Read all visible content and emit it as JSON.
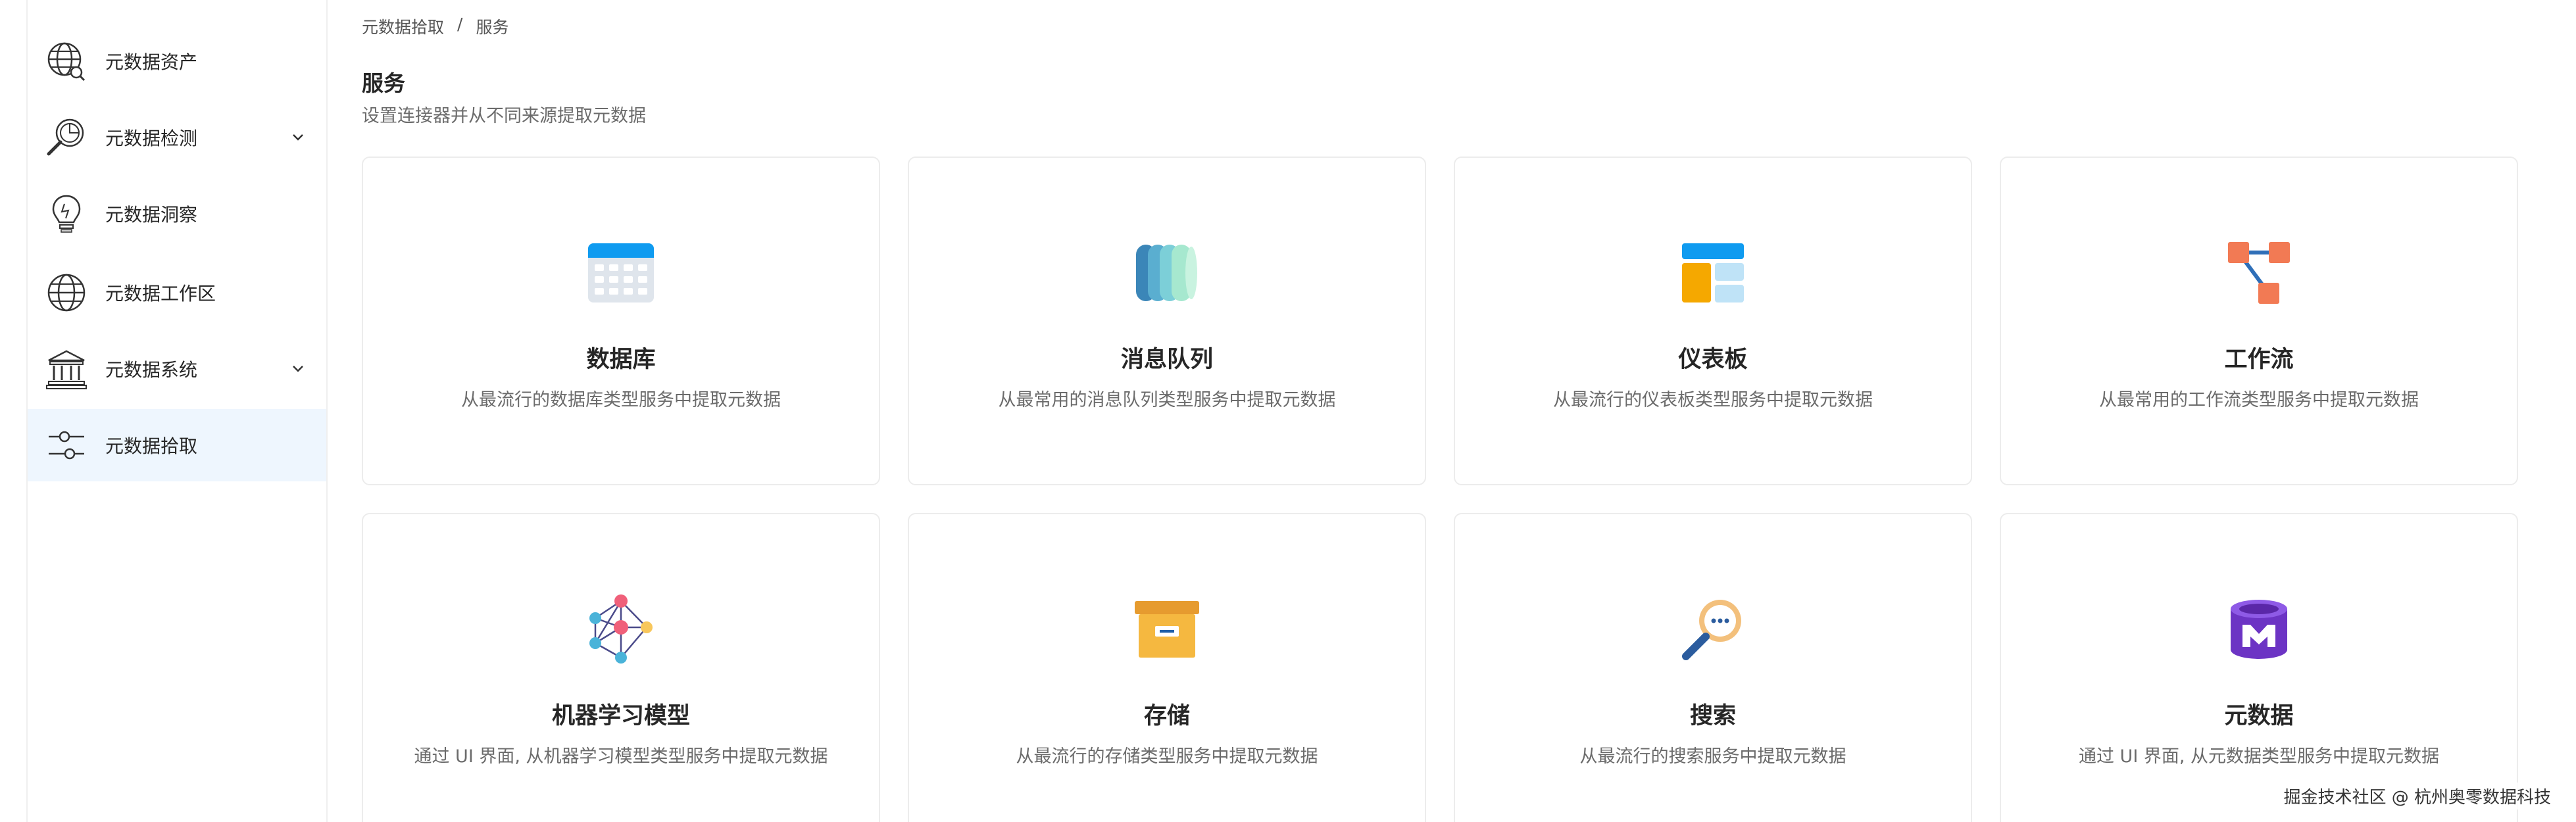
{
  "sidebar": {
    "items": [
      {
        "label": "元数据资产",
        "icon": "globe-search-icon",
        "has_chevron": false,
        "active": false
      },
      {
        "label": "元数据检测",
        "icon": "magnifier-chart-icon",
        "has_chevron": true,
        "active": false
      },
      {
        "label": "元数据洞察",
        "icon": "lightbulb-icon",
        "has_chevron": false,
        "active": false
      },
      {
        "label": "元数据工作区",
        "icon": "globe-icon",
        "has_chevron": false,
        "active": false
      },
      {
        "label": "元数据系统",
        "icon": "bank-building-icon",
        "has_chevron": true,
        "active": false
      },
      {
        "label": "元数据拾取",
        "icon": "sliders-icon",
        "has_chevron": false,
        "active": true
      }
    ]
  },
  "breadcrumb": {
    "items": [
      "元数据拾取",
      "服务"
    ],
    "separator": "/"
  },
  "page": {
    "title": "服务",
    "subtitle": "设置连接器并从不同来源提取元数据"
  },
  "cards": [
    {
      "title": "数据库",
      "description": "从最流行的数据库类型服务中提取元数据",
      "icon": "database-table-icon"
    },
    {
      "title": "消息队列",
      "description": "从最常用的消息队列类型服务中提取元数据",
      "icon": "message-queue-icon"
    },
    {
      "title": "仪表板",
      "description": "从最流行的仪表板类型服务中提取元数据",
      "icon": "dashboard-icon"
    },
    {
      "title": "工作流",
      "description": "从最常用的工作流类型服务中提取元数据",
      "icon": "workflow-icon"
    },
    {
      "title": "机器学习模型",
      "description": "通过 UI 界面, 从机器学习模型类型服务中提取元数据",
      "icon": "ml-network-icon"
    },
    {
      "title": "存储",
      "description": "从最流行的存储类型服务中提取元数据",
      "icon": "storage-box-icon"
    },
    {
      "title": "搜索",
      "description": "从最流行的搜索服务中提取元数据",
      "icon": "search-magnifier-icon"
    },
    {
      "title": "元数据",
      "description": "通过 UI 界面, 从元数据类型服务中提取元数据",
      "icon": "metadata-cylinder-icon"
    }
  ],
  "watermark": {
    "text": "掘金技术社区 @ 杭州奥零数据科技"
  },
  "colors": {
    "active_nav_bg": "#eef6fe",
    "card_border": "#ececec",
    "accent_blue": "#0f9bf0",
    "accent_orange": "#f08a5d",
    "accent_yellow": "#f5b82e",
    "accent_purple": "#7a3fd1"
  }
}
